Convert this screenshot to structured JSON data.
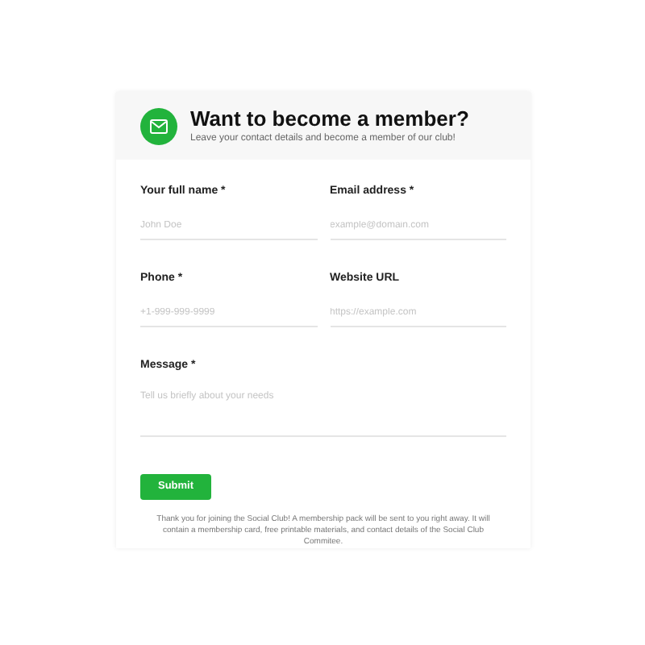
{
  "header": {
    "title": "Want to become a member?",
    "subtitle": "Leave your contact details and become a member of our club!"
  },
  "fields": [
    {
      "label": "Your full name *",
      "placeholder": "John Doe",
      "kind": "input"
    },
    {
      "label": "Email address *",
      "placeholder": "example@domain.com",
      "kind": "input"
    },
    {
      "label": "Phone *",
      "placeholder": "+1-999-999-9999",
      "kind": "input"
    },
    {
      "label": "Website URL",
      "placeholder": "https://example.com",
      "kind": "input"
    },
    {
      "label": "Message *",
      "placeholder": "Tell us briefly about your needs",
      "kind": "textarea"
    }
  ],
  "submit": "Submit",
  "note": "Thank you for joining the Social Club! A membership pack will be sent to you right away. It will contain a membership card, free printable materials, and contact details of the Social Club Commitee."
}
